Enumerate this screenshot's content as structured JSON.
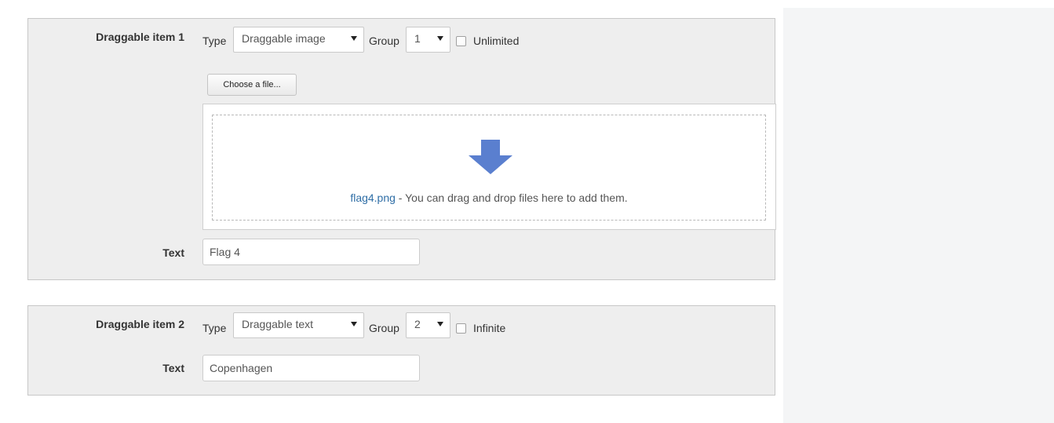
{
  "items": [
    {
      "label": "Draggable item 1",
      "type_label": "Type",
      "type_value": "Draggable image",
      "group_label": "Group",
      "group_value": "1",
      "checkbox_label": "Unlimited",
      "checkbox_checked": false,
      "choose_file_label": "Choose a file...",
      "file_name": "flag4.png",
      "drop_hint": " - You can drag and drop files here to add them.",
      "text_label": "Text",
      "text_value": "Flag 4"
    },
    {
      "label": "Draggable item 2",
      "type_label": "Type",
      "type_value": "Draggable text",
      "group_label": "Group",
      "group_value": "2",
      "checkbox_label": "Infinite",
      "checkbox_checked": false,
      "text_label": "Text",
      "text_value": "Copenhagen"
    }
  ],
  "icons": {
    "drop_arrow": "arrow-down-icon",
    "select_caret": "caret-down-icon"
  },
  "colors": {
    "panel_bg": "#eeeeee",
    "link": "#2f6ea6",
    "arrow": "#5a7fcf"
  }
}
